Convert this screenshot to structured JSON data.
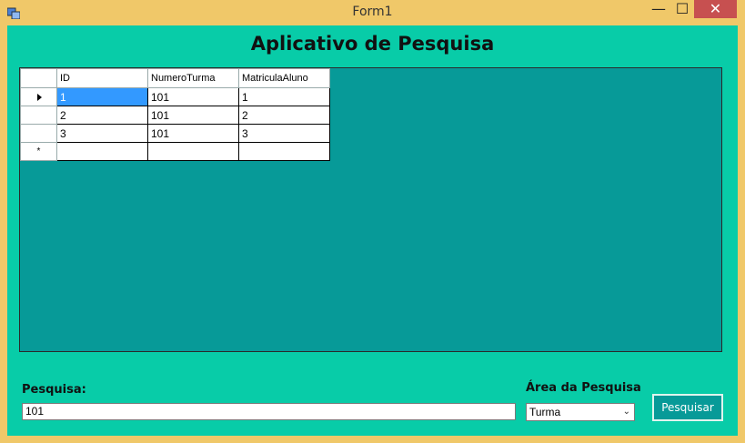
{
  "window": {
    "title": "Form1",
    "controls": {
      "minimize": "—",
      "maximize": "☐",
      "close": "✕"
    }
  },
  "form": {
    "heading": "Aplicativo de Pesquisa",
    "grid": {
      "columns": [
        "ID",
        "NumeroTurma",
        "MatriculaAluno"
      ],
      "rows": [
        [
          "1",
          "101",
          "1"
        ],
        [
          "2",
          "101",
          "2"
        ],
        [
          "3",
          "101",
          "3"
        ]
      ],
      "new_row_marker": "*"
    },
    "search": {
      "label": "Pesquisa:",
      "value": "101"
    },
    "area": {
      "label": "Área da Pesquisa",
      "selected": "Turma"
    },
    "button": {
      "label": "Pesquisar"
    }
  },
  "colors": {
    "window_frame": "#f0c869",
    "client_bg": "#08cca8",
    "grid_bg": "#079a98",
    "selection": "#3399ff"
  }
}
